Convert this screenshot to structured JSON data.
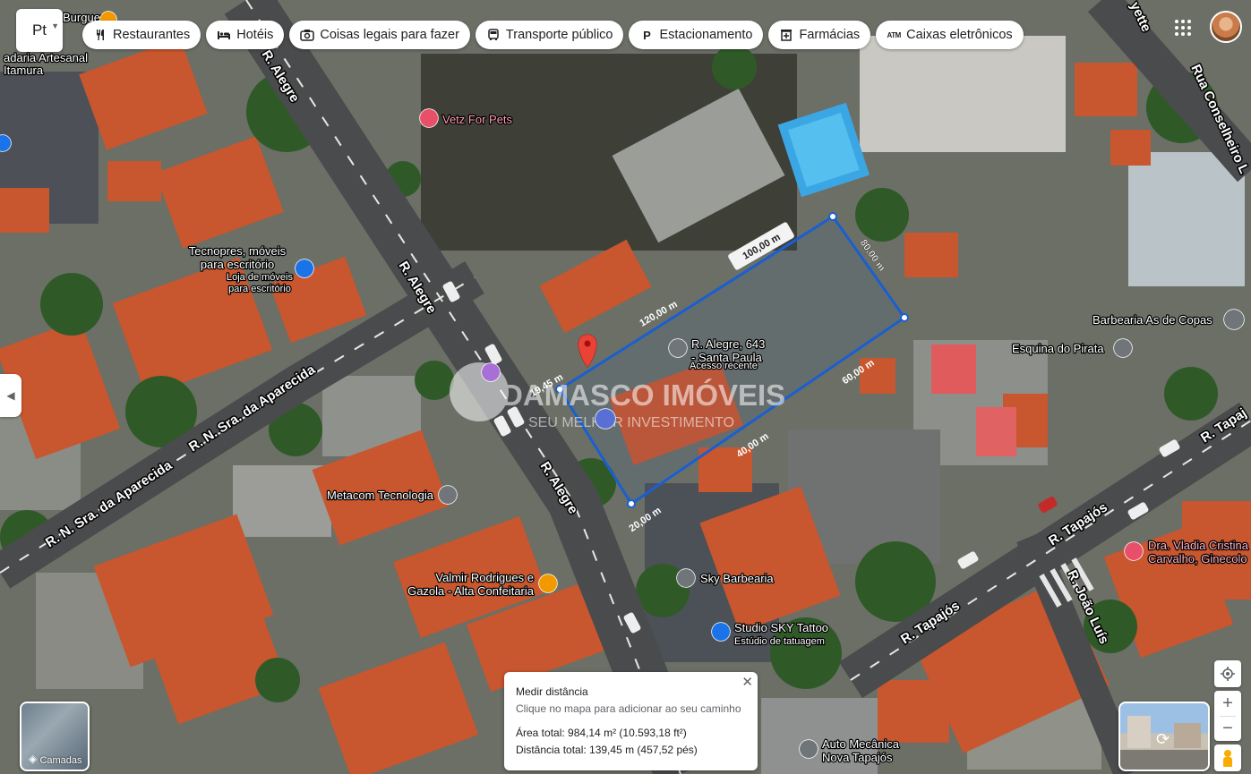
{
  "search": {
    "value": "Pt"
  },
  "chips": [
    {
      "label": "Restaurantes",
      "icon": "utensils-icon"
    },
    {
      "label": "Hotéis",
      "icon": "bed-icon"
    },
    {
      "label": "Coisas legais para fazer",
      "icon": "camera-icon"
    },
    {
      "label": "Transporte público",
      "icon": "bus-icon"
    },
    {
      "label": "Estacionamento",
      "icon": "parking-icon"
    },
    {
      "label": "Farmácias",
      "icon": "pharmacy-icon"
    },
    {
      "label": "Caixas eletrônicos",
      "icon": "atm-icon"
    }
  ],
  "pois": {
    "vetz": "Vetz For Pets",
    "tecnopres": [
      "Tecnopres, móveis",
      "para escritório"
    ],
    "tecnopres_sub": [
      "Loja de móveis",
      "para escritório"
    ],
    "target": [
      "R. Alegre, 643",
      "- Santa Paula"
    ],
    "target_sub": "Acesso recente",
    "barbearia_as": "Barbearia As de Copas",
    "esquina": "Esquina do Pirata",
    "metacom": "Metacom Tecnologia",
    "valmir": [
      "Valmir Rodrigues e",
      "Gazola - Alta Confeitaria"
    ],
    "sky_barbearia": "Sky Barbearia",
    "studio_sky": "Studio SKY Tattoo",
    "studio_sky_sub": "Estúdio de tatuagem",
    "vladia": [
      "Dra. Vladia Cristina",
      "Carvalho, Ginecolo"
    ],
    "auto": [
      "Auto Mecânica",
      "Nova Tapajós"
    ],
    "artesanal": [
      "adaria Artesanal",
      "Itamura"
    ],
    "burger": "Burguer"
  },
  "streets": {
    "alegre_1": "R. Alegre",
    "alegre_2": "R. Alegre",
    "alegre_3": "R. Alegre",
    "aparecida_1": "R. N. Sra. da Aparecida",
    "aparecida_2": "R. N. Sra. da Aparecida",
    "tapajos_1": "R. Tapajós",
    "tapajos_2": "R. Tapajós",
    "tapajos_3": "R. Tapaj",
    "joao": "R. João Luís",
    "conselheiro": "Rua Conselheiro L",
    "lafayette": "yette"
  },
  "measurements": {
    "top": "100,00 m",
    "right_top": "80,00 m",
    "right": "60,00 m",
    "bottom": "40,00 m",
    "left_bottom": "20,00 m",
    "left": "120,00 m",
    "left_short": "19,45 m"
  },
  "watermark": {
    "main": "DAMASCO IMÓVEIS",
    "sub": "SEU MELHOR INVESTIMENTO"
  },
  "measure_panel": {
    "title": "Medir distância",
    "hint": "Clique no mapa para adicionar ao seu caminho",
    "area": "Área total: 984,14 m² (10.593,18 ft²)",
    "distance": "Distância total: 139,45 m (457,52 pés)"
  },
  "layers": {
    "label": "Camadas"
  },
  "colors": {
    "measure_line": "#1a5fd0",
    "pin": "#ea4335",
    "poi_grey": "#70757a",
    "poi_blue": "#1a73e8"
  }
}
